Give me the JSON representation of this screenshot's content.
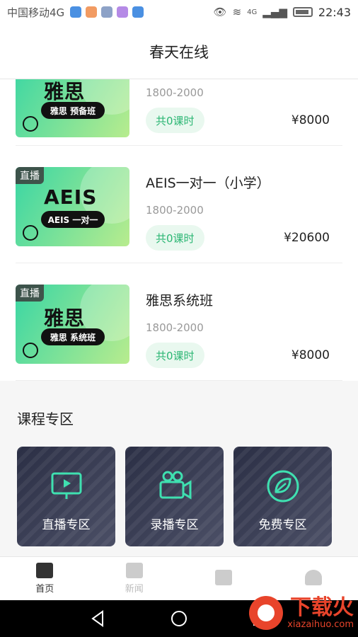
{
  "status_bar": {
    "carrier": "中国移动4G",
    "time": "22:43",
    "network": "4G"
  },
  "header": {
    "title": "春天在线"
  },
  "courses": [
    {
      "thumb_big": "雅思",
      "thumb_pill": "雅思 预备班",
      "live_tag": "",
      "title": "",
      "time_range": "1800-2000",
      "lessons": "共0课时",
      "price": "¥8000"
    },
    {
      "thumb_big": "AEIS",
      "thumb_pill": "AEIS 一对一",
      "live_tag": "直播",
      "title": "AEIS一对一（小学）",
      "time_range": "1800-2000",
      "lessons": "共0课时",
      "price": "¥20600"
    },
    {
      "thumb_big": "雅思",
      "thumb_pill": "雅思 系统班",
      "live_tag": "直播",
      "title": "雅思系统班",
      "time_range": "1800-2000",
      "lessons": "共0课时",
      "price": "¥8000"
    }
  ],
  "zone_section": {
    "title": "课程专区",
    "cards": [
      {
        "label": "直播专区",
        "icon": "tv-play-icon"
      },
      {
        "label": "录播专区",
        "icon": "video-camera-icon"
      },
      {
        "label": "免费专区",
        "icon": "leaf-icon"
      }
    ]
  },
  "tabbar": {
    "items": [
      {
        "label": "首页",
        "active": true
      },
      {
        "label": "新闻",
        "active": false
      },
      {
        "label": "",
        "active": false
      },
      {
        "label": "",
        "active": false
      }
    ]
  },
  "watermark": {
    "cn": "下载火",
    "en": "xiazaihuo.com"
  },
  "colors": {
    "accent_green": "#2bb673",
    "lessons_bg": "#e9f8ef"
  }
}
